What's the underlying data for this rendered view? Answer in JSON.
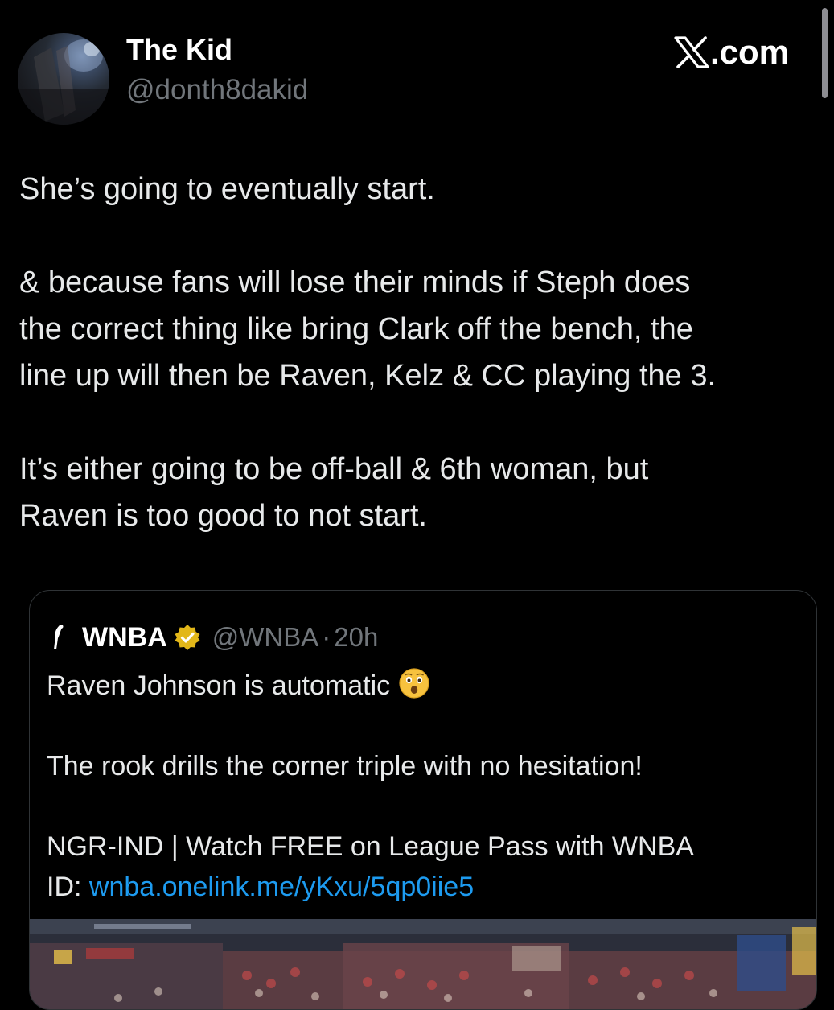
{
  "post": {
    "author": {
      "display_name": "The Kid",
      "handle": "@donth8dakid"
    },
    "brand": {
      "icon": "x-logo-icon",
      "text": ".com"
    },
    "body": [
      "She’s going to eventually start.",
      "",
      "& because fans will lose their minds if Steph does",
      "the correct thing like bring Clark off the bench, the",
      "line up will then be Raven, Kelz & CC playing the 3.",
      "",
      "It’s either going to be off-ball & 6th woman, but",
      "Raven is too good to not start."
    ]
  },
  "quoted_post": {
    "author": {
      "display_name": "WNBA",
      "verified_badge": "gold-verified-badge-icon",
      "handle": "@WNBA",
      "separator": "·",
      "time": "20h"
    },
    "line_1_text": "Raven Johnson is automatic",
    "line_1_emoji": "astonished-face-emoji-icon",
    "line_2": "The rook drills the corner triple with no hesitation!",
    "line_3": "NGR-IND | Watch FREE on League Pass with WNBA",
    "line_4_prefix": "ID: ",
    "link": "wnba.onelink.me/yKxu/5qp0iie5",
    "media": "basketball-arena-video-thumbnail"
  },
  "colors": {
    "background": "#000000",
    "text_primary": "#e7e9ea",
    "text_secondary": "#71767b",
    "link": "#1d9bf0",
    "border": "#2f3336",
    "verified_gold": "#e2b719"
  }
}
